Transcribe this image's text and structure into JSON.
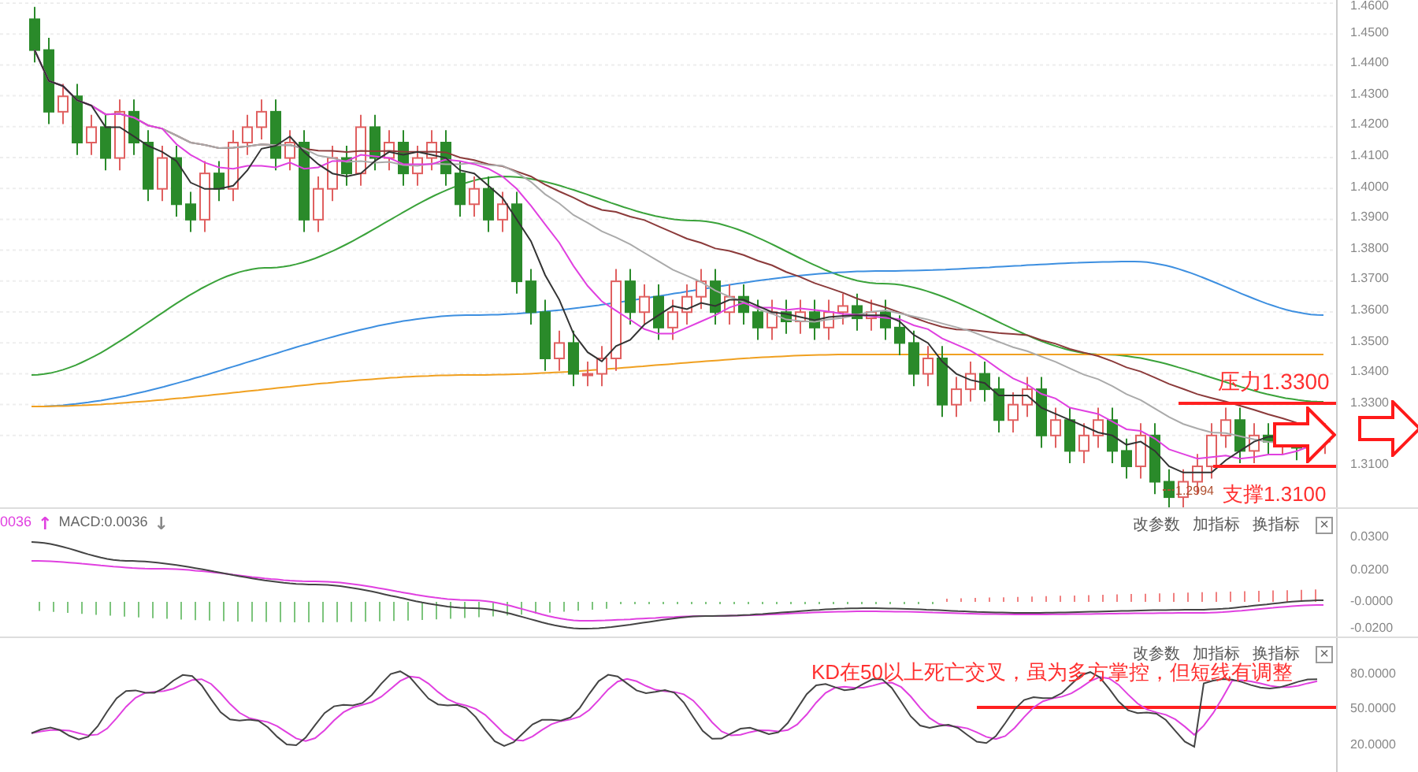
{
  "price_axis": {
    "ticks": [
      "1.4600",
      "1.4500",
      "1.4400",
      "1.4300",
      "1.4200",
      "1.4100",
      "1.4000",
      "1.3900",
      "1.3800",
      "1.3700",
      "1.3600",
      "1.3500",
      "1.3400",
      "1.3300",
      "1.3100"
    ]
  },
  "main_chart": {
    "low_marker": "1.2994",
    "resistance": {
      "label": "压力1.3300"
    },
    "support": {
      "label": "支撑1.3100"
    }
  },
  "macd_panel": {
    "header": [
      {
        "text": "0036",
        "color": "#e040e0"
      },
      {
        "text": "↑",
        "color": "#e040e0"
      },
      {
        "text": "MACD:0.0036",
        "color": "#666666"
      },
      {
        "text": "↓",
        "color": "#888888"
      }
    ],
    "buttons": [
      "改参数",
      "加指标",
      "换指标"
    ],
    "close": "×",
    "ticks": [
      "0.0300",
      "0.0200",
      "-0.0000",
      "-0.0200"
    ]
  },
  "kd_panel": {
    "buttons": [
      "改参数",
      "加指标",
      "换指标"
    ],
    "close": "×",
    "ticks": [
      "80.0000",
      "50.0000",
      "20.0000"
    ],
    "annotation": "KD在50以上死亡交叉，虽为多方掌控，但短线有调整"
  }
}
